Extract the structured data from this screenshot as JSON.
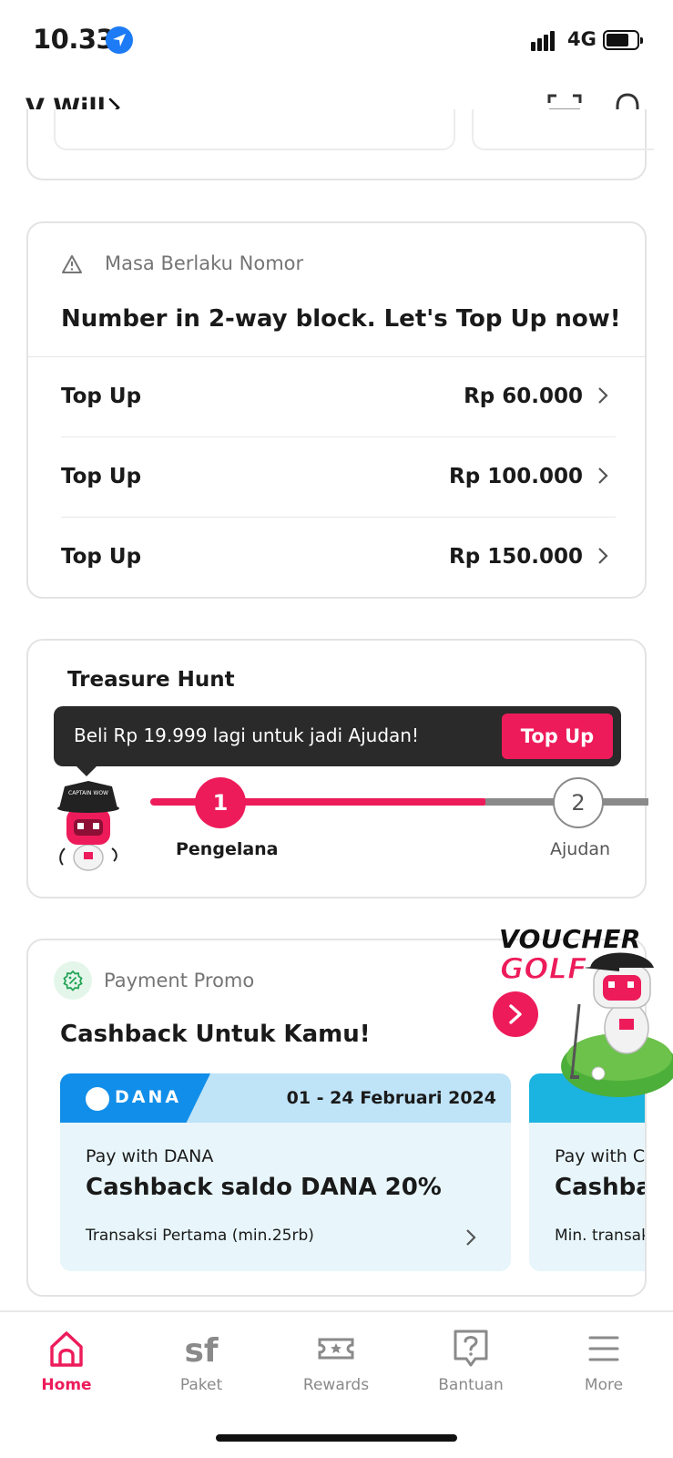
{
  "status_bar": {
    "time": "10.33",
    "network": "4G"
  },
  "header": {
    "user_name": "V Will"
  },
  "masa": {
    "label": "Masa Berlaku Nomor",
    "title": "Number in 2-way block. Let's Top Up now!",
    "options": [
      {
        "label": "Top Up",
        "amount": "Rp 60.000"
      },
      {
        "label": "Top Up",
        "amount": "Rp 100.000"
      },
      {
        "label": "Top Up",
        "amount": "Rp 150.000"
      }
    ]
  },
  "treasure": {
    "title": "Treasure Hunt",
    "tooltip": "Beli Rp 19.999 lagi untuk jadi Ajudan!",
    "tooltip_button": "Top Up",
    "steps": [
      {
        "number": "1",
        "label": "Pengelana"
      },
      {
        "number": "2",
        "label": "Ajudan"
      }
    ],
    "mascot_badge": "CAPTAIN WOW"
  },
  "promo": {
    "label": "Payment Promo",
    "title": "Cashback Untuk Kamu!",
    "voucher_line1": "VOUCHER",
    "voucher_line2": "GOLF",
    "offers": [
      {
        "brand": "DANA",
        "date": "01 - 24 Februari 2024",
        "pay": "Pay with DANA",
        "cashback": "Cashback saldo DANA 20%",
        "condition": "Transaksi Pertama (min.25rb)"
      },
      {
        "brand": "",
        "date": "",
        "pay": "Pay with C",
        "cashback": "Cashba",
        "condition": "Min. transak"
      }
    ]
  },
  "nav": {
    "items": [
      {
        "label": "Home",
        "icon": "home-icon"
      },
      {
        "label": "Paket",
        "icon": "sf-icon"
      },
      {
        "label": "Rewards",
        "icon": "ticket-icon"
      },
      {
        "label": "Bantuan",
        "icon": "help-icon"
      },
      {
        "label": "More",
        "icon": "menu-icon"
      }
    ]
  },
  "colors": {
    "accent": "#ed1b5a",
    "dana_blue": "#118ee9",
    "offer_bg": "#e8f6fb"
  }
}
